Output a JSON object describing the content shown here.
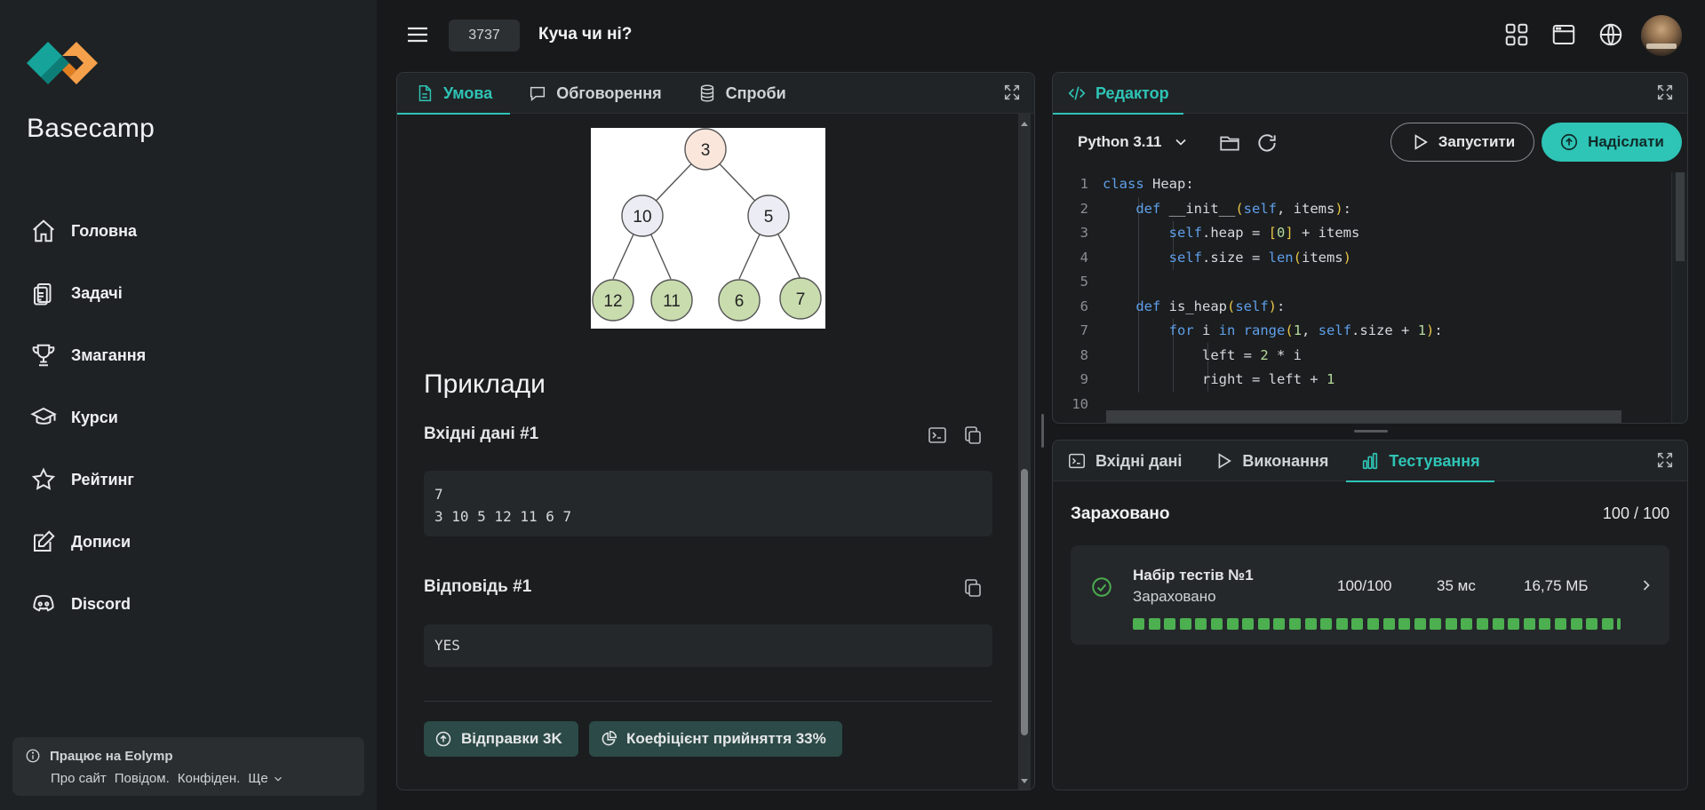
{
  "sidebar": {
    "brand": "Basecamp",
    "nav": [
      {
        "label": "Головна",
        "icon": "home-icon"
      },
      {
        "label": "Задачі",
        "icon": "clipboard-icon"
      },
      {
        "label": "Змагання",
        "icon": "trophy-icon"
      },
      {
        "label": "Курси",
        "icon": "graduation-cap-icon"
      },
      {
        "label": "Рейтинг",
        "icon": "star-icon"
      },
      {
        "label": "Дописи",
        "icon": "edit-icon"
      },
      {
        "label": "Discord",
        "icon": "discord-icon"
      }
    ],
    "footer": {
      "title": "Працює на Eolymp",
      "links": [
        "Про сайт",
        "Повідом.",
        "Конфіден.",
        "Ще"
      ]
    }
  },
  "header": {
    "problem_id": "3737",
    "problem_title": "Куча чи ні?"
  },
  "left_panel": {
    "tabs": [
      {
        "label": "Умова",
        "icon": "document-icon",
        "active": true
      },
      {
        "label": "Обговорення",
        "icon": "chat-icon",
        "active": false
      },
      {
        "label": "Спроби",
        "icon": "database-icon",
        "active": false
      }
    ],
    "heap_nodes": [
      "3",
      "10",
      "5",
      "12",
      "11",
      "6",
      "7"
    ],
    "examples_heading": "Приклади",
    "input_title": "Вхідні дані #1",
    "input_text": "7\n3 10 5 12 11 6 7",
    "answer_title": "Відповідь #1",
    "answer_text": "YES",
    "submissions_label": "Відправки 3K",
    "acceptance_label": "Коефіцієнт прийняття 33%"
  },
  "editor_panel": {
    "tab_label": "Редактор",
    "language": "Python 3.11",
    "run_label": "Запустити",
    "submit_label": "Надіслати",
    "line_numbers": [
      "1",
      "2",
      "3",
      "4",
      "5",
      "6",
      "7",
      "8",
      "9",
      "10"
    ]
  },
  "result_panel": {
    "tabs": [
      {
        "label": "Вхідні дані",
        "active": false
      },
      {
        "label": "Виконання",
        "active": false
      },
      {
        "label": "Тестування",
        "active": true
      }
    ],
    "status": "Зараховано",
    "score": "100 / 100",
    "test_set": {
      "name": "Набір тестів №1",
      "status": "Зараховано",
      "points": "100/100",
      "time": "35 мс",
      "memory": "16,75 МБ",
      "passed_tests": 32
    }
  },
  "colors": {
    "accent": "#2ec4b6",
    "pass": "#4caf50",
    "logo_teal": "#16a39a",
    "logo_orange": "#f5a04a"
  }
}
